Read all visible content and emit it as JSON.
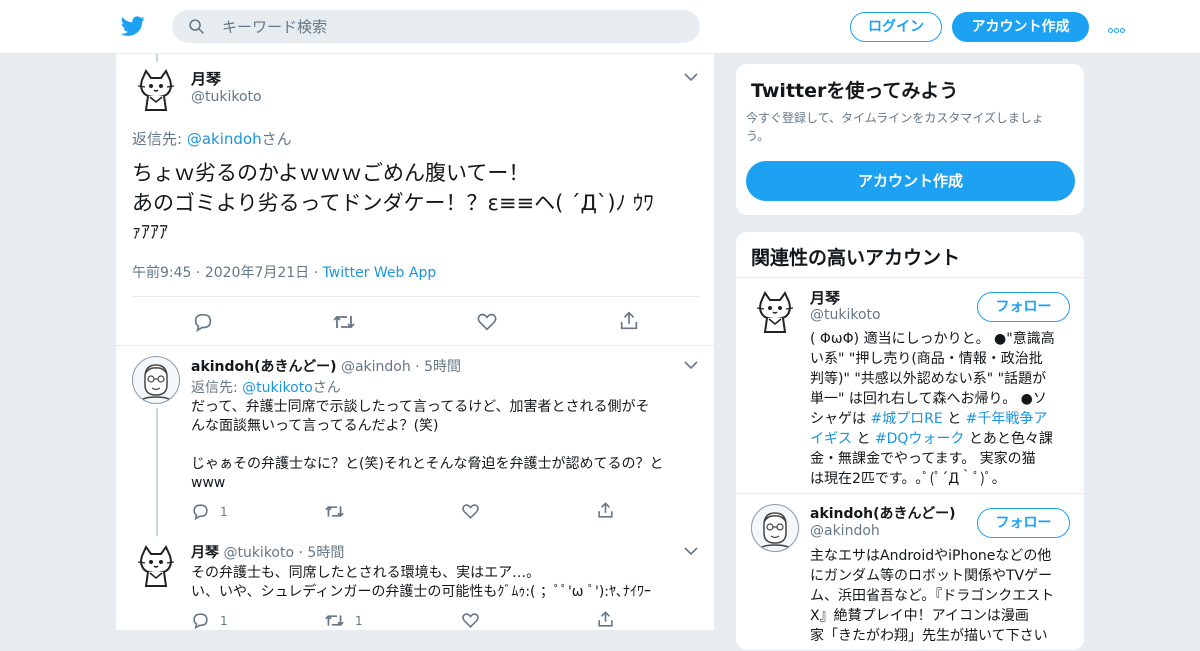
{
  "header": {
    "search_placeholder": "キーワード検索",
    "login_label": "ログイン",
    "signup_label": "アカウント作成",
    "accent": "#1da1f2"
  },
  "main_tweet": {
    "name": "月琴",
    "handle": "@tukikoto",
    "reply_prefix": "返信先: ",
    "reply_handle": "@akindoh",
    "reply_suffix": "さん",
    "text_line1": "ちょｗ劣るのかよｗｗｗごめん腹いてー！",
    "text_line2": "あのゴミより劣るってドンダケー！？ε≡≡ヘ( ´Д`)ﾉ ｳﾜ",
    "text_line3": "ｧｱｱｱ",
    "time": "午前9:45",
    "date": "2020年7月21日",
    "source": "Twitter Web App"
  },
  "replies": [
    {
      "name": "akindoh(あきんどー)",
      "handle": "@akindoh",
      "time": "5時間",
      "reply_prefix": "返信先: ",
      "reply_handle": "@tukikoto",
      "reply_suffix": "さん",
      "text_line1": "だって、弁護士同席で示談したって言ってるけど、加害者とされる側がそ",
      "text_line2": "んな面談無いって言ってるんだよ？(笑)",
      "text_line3": "じゃぁその弁護士なに？と(笑)それとそんな脅迫を弁護士が認めてるの？と",
      "text_line4": "www",
      "reply_count": "1",
      "retweet_count": ""
    },
    {
      "name": "月琴",
      "handle": "@tukikoto",
      "time": "5時間",
      "text_line1": "その弁護士も、同席したとされる環境も、実はエア…。",
      "text_line2": "い、いや、シュレディンガーの弁護士の可能性もｸﾞﾑｩ:( ；ﾟﾟ'ω ﾟ'):ﾔ､ﾅｲﾜｰ",
      "reply_count": "1",
      "retweet_count": "1"
    }
  ],
  "signup_card": {
    "title": "Twitterを使ってみよう",
    "desc_line1": "今すぐ登録して、タイムラインをカスタマイズしましょ",
    "desc_line2": "う。",
    "button": "アカウント作成"
  },
  "related": {
    "title": "関連性の高いアカウント",
    "follow_label": "フォロー",
    "accounts": [
      {
        "name": "月琴",
        "handle": "@tukikoto",
        "bio_lines": [
          "( ΦωΦ) 適当にしっかりと。 ●\"意識高",
          "い系\" \"押し売り(商品・情報・政治批",
          "判等)\" \"共感以外認めない系\" \"話題が",
          "単一\" は回れ右して森へお帰り。 ●ソ"
        ],
        "bio_l5_a": "シャゲは ",
        "bio_l5_tag1": "#城プロRE",
        "bio_l5_b": " と ",
        "bio_l5_tag2": "#千年戦争ア",
        "bio_l6_tag2b": "イギス",
        "bio_l6_b": " と ",
        "bio_l6_tag3": "#DQウォーク",
        "bio_l6_c": " とあと色々課",
        "bio_l7": "金・無課金でやってます。 実家の猫",
        "bio_l8": "は現在2匹です。｡ﾟ(ﾟ´Д｀ﾟ)ﾟ｡"
      },
      {
        "name": "akindoh(あきんどー)",
        "handle": "@akindoh",
        "bio_lines": [
          "主なエサはAndroidやiPhoneなどの他",
          "にガンダム等のロボット関係やTVゲー",
          "ム、浜田省吾など。『ドラゴンクエスト",
          "X』絶賛プレイ中！アイコンは漫画",
          "家「きたがわ翔」先生が描いて下さい"
        ]
      }
    ]
  }
}
